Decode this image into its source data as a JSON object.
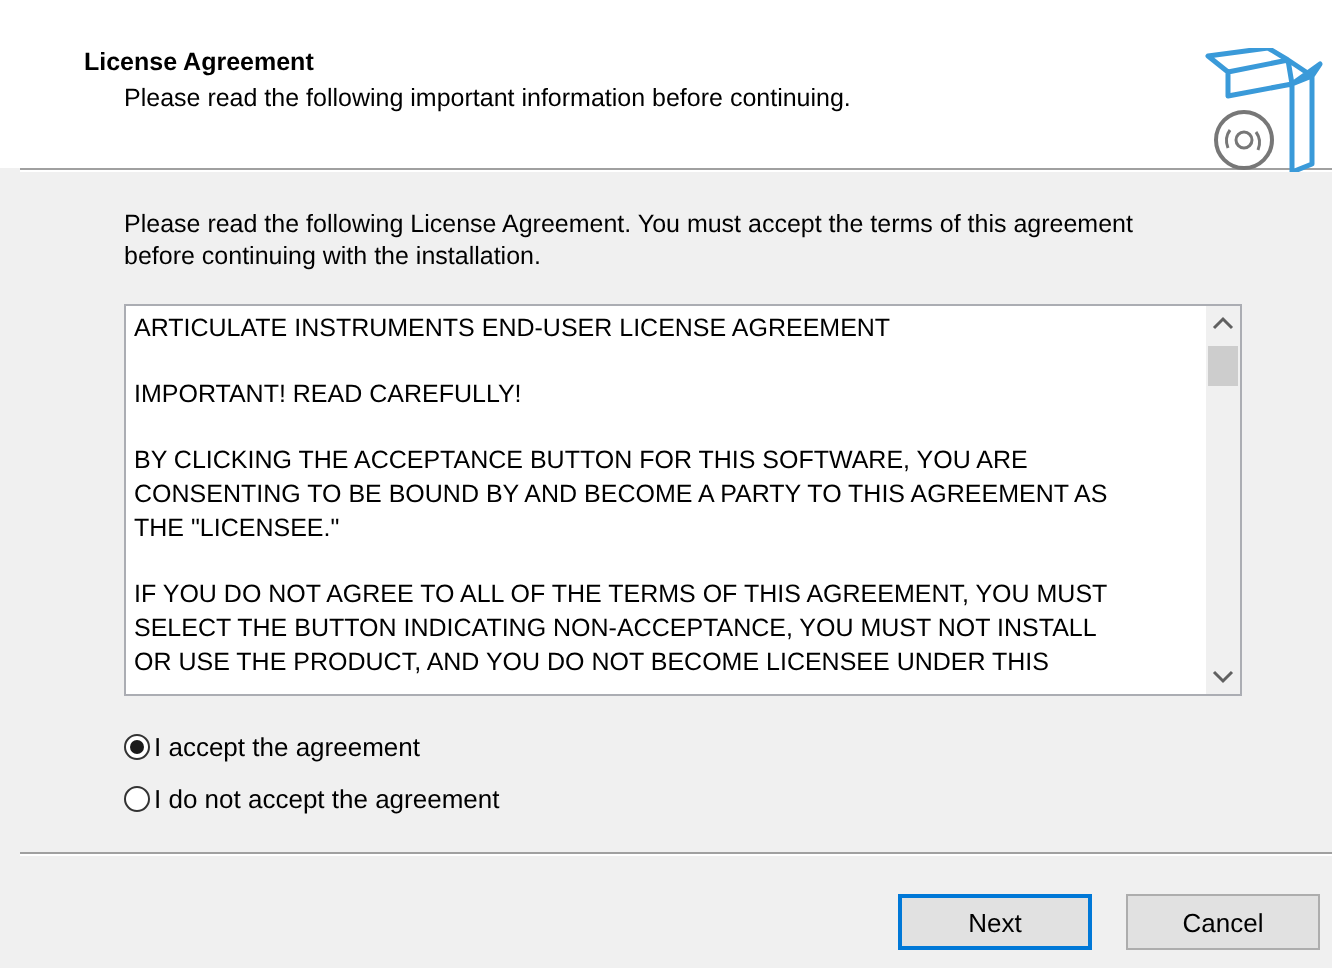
{
  "header": {
    "title": "License Agreement",
    "subtitle": "Please read the following important information before continuing."
  },
  "intro": "Please read the following License Agreement. You must accept the terms of this agreement before continuing with the installation.",
  "license_paragraphs": [
    {
      "lines": [
        "ARTICULATE INSTRUMENTS END-USER LICENSE AGREEMENT"
      ]
    },
    {
      "lines": [
        "IMPORTANT! READ CAREFULLY!"
      ]
    },
    {
      "lines": [
        "BY CLICKING THE ACCEPTANCE BUTTON FOR THIS SOFTWARE, YOU ARE",
        "CONSENTING TO BE BOUND BY AND BECOME A PARTY TO THIS AGREEMENT AS",
        "THE \"LICENSEE.\""
      ]
    },
    {
      "lines": [
        "IF YOU DO NOT AGREE TO ALL OF THE TERMS OF THIS AGREEMENT, YOU MUST",
        "SELECT THE BUTTON INDICATING NON-ACCEPTANCE, YOU MUST NOT INSTALL",
        "OR USE THE PRODUCT, AND YOU DO NOT BECOME LICENSEE UNDER THIS"
      ]
    }
  ],
  "options": [
    {
      "label": "I accept the agreement",
      "selected": true
    },
    {
      "label": "I do not accept the agreement",
      "selected": false
    }
  ],
  "buttons": [
    {
      "label": "Next",
      "default": true
    },
    {
      "label": "Cancel",
      "default": false
    }
  ]
}
